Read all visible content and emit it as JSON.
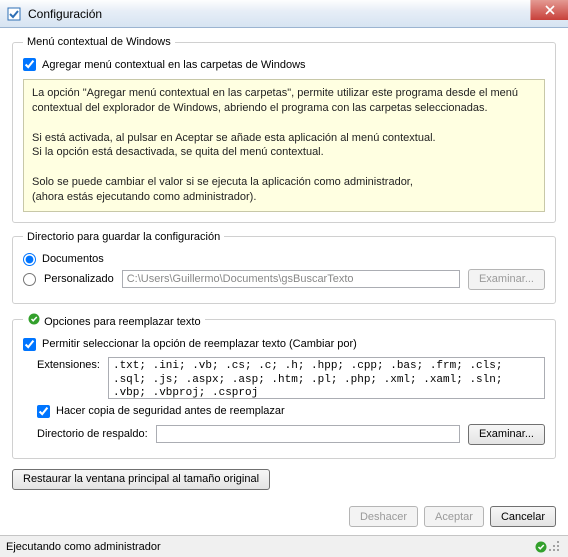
{
  "window": {
    "title": "Configuración"
  },
  "groups": {
    "context_menu": {
      "legend": "Menú contextual de Windows",
      "checkbox_label": "Agregar menú contextual en las carpetas de Windows",
      "checkbox_checked": true,
      "info_text": "La opción \"Agregar menú contextual en las carpetas\", permite utilizar este programa desde el menú contextual del explorador de Windows, abriendo el programa con las carpetas seleccionadas.\n\nSi está activada, al pulsar en Aceptar se añade esta aplicación al menú contextual.\nSi la opción está desactivada, se quita del menú contextual.\n\nSolo se puede cambiar el valor si se ejecuta la aplicación como administrador,\n(ahora estás ejecutando como administrador)."
    },
    "config_dir": {
      "legend": "Directorio para guardar la configuración",
      "radio_documents": "Documentos",
      "radio_custom": "Personalizado",
      "custom_path": "C:\\Users\\Guillermo\\Documents\\gsBuscarTexto",
      "browse_label": "Examinar..."
    },
    "replace": {
      "legend": "Opciones para reemplazar texto",
      "allow_label": "Permitir seleccionar la opción de reemplazar texto (Cambiar por)",
      "allow_checked": true,
      "ext_label": "Extensiones:",
      "ext_value": ".txt; .ini; .vb; .cs; .c; .h; .hpp; .cpp; .bas; .frm; .cls; .sql; .js; .aspx; .asp; .htm; .pl; .php; .xml; .xaml; .sln; .vbp; .vbproj; .csproj",
      "backup_label": "Hacer copia de seguridad antes de reemplazar",
      "backup_checked": true,
      "backup_dir_label": "Directorio de respaldo:",
      "backup_dir_value": "",
      "browse_label": "Examinar..."
    }
  },
  "restore_button": "Restaurar la ventana principal al tamaño original",
  "buttons": {
    "undo": "Deshacer",
    "ok": "Aceptar",
    "cancel": "Cancelar"
  },
  "status": {
    "text": "Ejecutando como administrador"
  }
}
